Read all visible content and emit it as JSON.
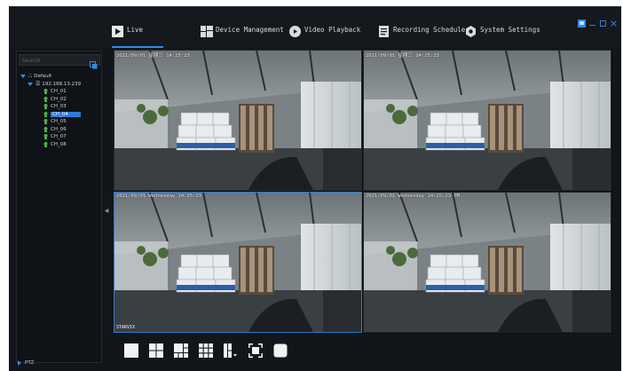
{
  "nav": {
    "items": [
      {
        "label": "Live",
        "icon": "play-icon"
      },
      {
        "label": "Device Management",
        "icon": "device-grid-icon"
      },
      {
        "label": "Video Playback",
        "icon": "playback-icon"
      },
      {
        "label": "Recording Schedule",
        "icon": "schedule-icon"
      },
      {
        "label": "System Settings",
        "icon": "gear-icon"
      }
    ],
    "active": "Live",
    "accent": "#2d8cf0"
  },
  "window_controls": {
    "icons": [
      "app-icon",
      "minimize-icon",
      "restore-icon",
      "close-icon"
    ]
  },
  "sidebar": {
    "search_placeholder": "Search",
    "tree": {
      "root": "Default",
      "device": "192.168.13.239",
      "channels": [
        "CH_01",
        "CH_02",
        "CH_03",
        "CH_04",
        "CH_05",
        "CH_06",
        "CH_07",
        "CH_08"
      ],
      "selected": "CH_04"
    },
    "ptz_label": "PTZ"
  },
  "tiles": [
    {
      "osd": "2021/09/01 星期三 14:25:23",
      "footer": ""
    },
    {
      "osd": "2021/09/01 星期三 14:25:23",
      "footer": ""
    },
    {
      "osd": "2021/09/01 Wednesday 14:25:23",
      "footer": "STARVIX"
    },
    {
      "osd": "2021/09/01 Wednesday 14:25:23 PM",
      "footer": ""
    }
  ],
  "toolbar": {
    "buttons": [
      "layout-1-icon",
      "layout-4-icon",
      "layout-6-icon",
      "layout-9-icon",
      "layout-custom-icon",
      "fullscreen-icon",
      "stop-all-icon"
    ]
  },
  "colors": {
    "background": "#121519",
    "accent": "#2d8cf0",
    "selected": "#2d7bd8"
  }
}
